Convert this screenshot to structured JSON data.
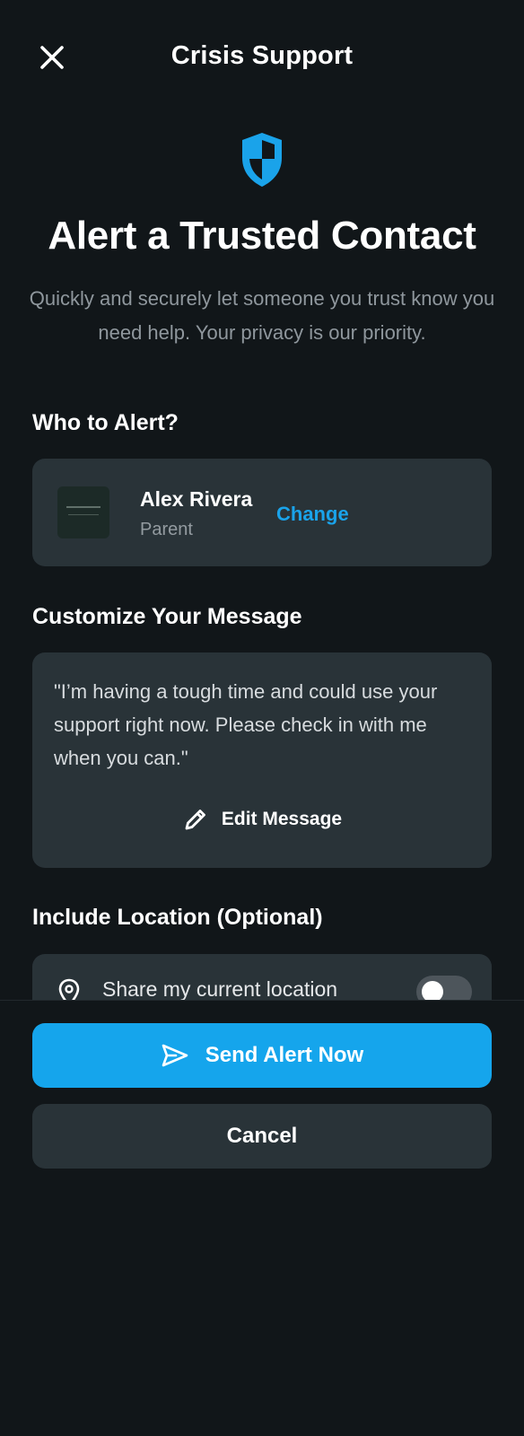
{
  "header": {
    "title": "Crisis Support",
    "close_icon": "close-icon"
  },
  "hero": {
    "icon": "shield-icon",
    "title": "Alert a Trusted Contact",
    "subtitle": "Quickly and securely let someone you trust know you need help. Your privacy is our priority.",
    "accent_color": "#1aa3ea"
  },
  "who": {
    "label": "Who to Alert?",
    "contact": {
      "name": "Alex Rivera",
      "relation": "Parent",
      "avatar": "avatar"
    },
    "change_label": "Change"
  },
  "message": {
    "label": "Customize Your Message",
    "text": "\"I’m having a tough time and could use your support right now. Please check in with me when you can.\"",
    "edit_label": "Edit Message",
    "edit_icon": "pencil-icon"
  },
  "location": {
    "label": "Include Location (Optional)",
    "option_label": "Share my current location",
    "icon": "location-pin-icon",
    "enabled": false
  },
  "actions": {
    "send_label": "Send Alert Now",
    "send_icon": "send-icon",
    "cancel_label": "Cancel"
  },
  "colors": {
    "background": "#111619",
    "card": "#293338",
    "primary": "#15a5ec"
  }
}
